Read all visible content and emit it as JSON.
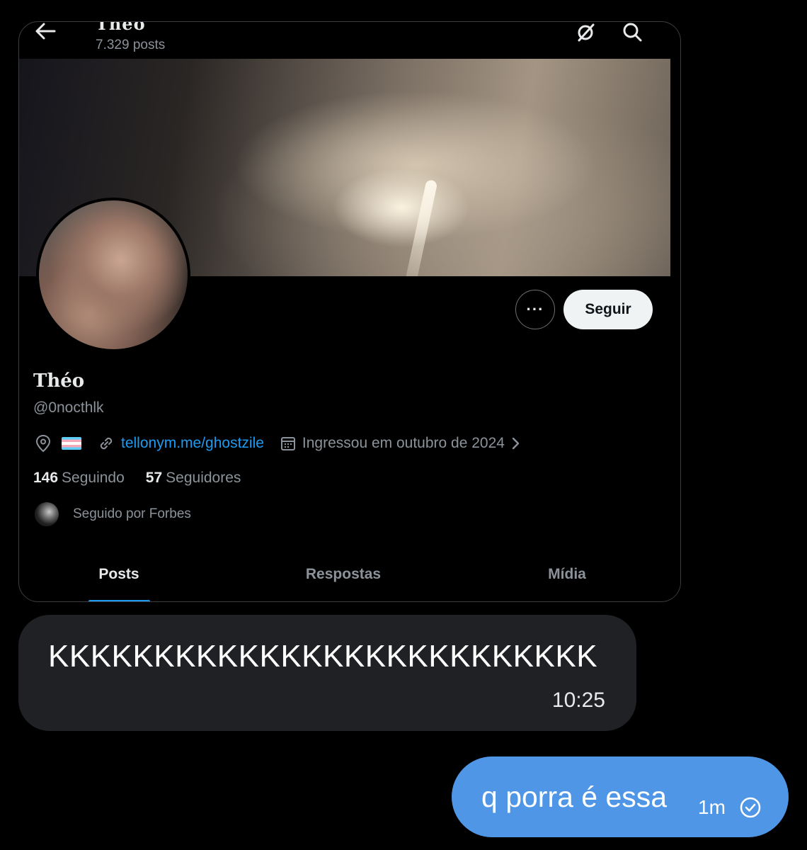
{
  "profile_card": {
    "topbar": {
      "title": "Théo",
      "post_count": "7.329 posts"
    },
    "display_name": "Théo",
    "handle": "@0nocthlk",
    "actions": {
      "more_label": "···",
      "follow_label": "Seguir"
    },
    "meta": {
      "website": "tellonym.me/ghostzile",
      "joined": "Ingressou em outubro de 2024"
    },
    "stats": {
      "following_count": "146",
      "following_label": "Seguindo",
      "followers_count": "57",
      "followers_label": "Seguidores"
    },
    "followed_by": "Seguido por Forbes",
    "tabs": [
      {
        "label": "Posts",
        "active": true
      },
      {
        "label": "Respostas",
        "active": false
      },
      {
        "label": "Mídia",
        "active": false
      }
    ]
  },
  "messages": [
    {
      "direction": "incoming",
      "text": "KKKKKKKKKKKKKKKKKKKKKKKKKK",
      "time": "10:25"
    },
    {
      "direction": "outgoing",
      "text": "q porra é essa",
      "time": "1m",
      "status_icon": "check-circle-icon"
    }
  ],
  "colors": {
    "accent": "#1d9bf0",
    "outgoing_bubble": "#4f97e6",
    "incoming_bubble": "#1f2124",
    "muted_text": "#8b9299"
  }
}
